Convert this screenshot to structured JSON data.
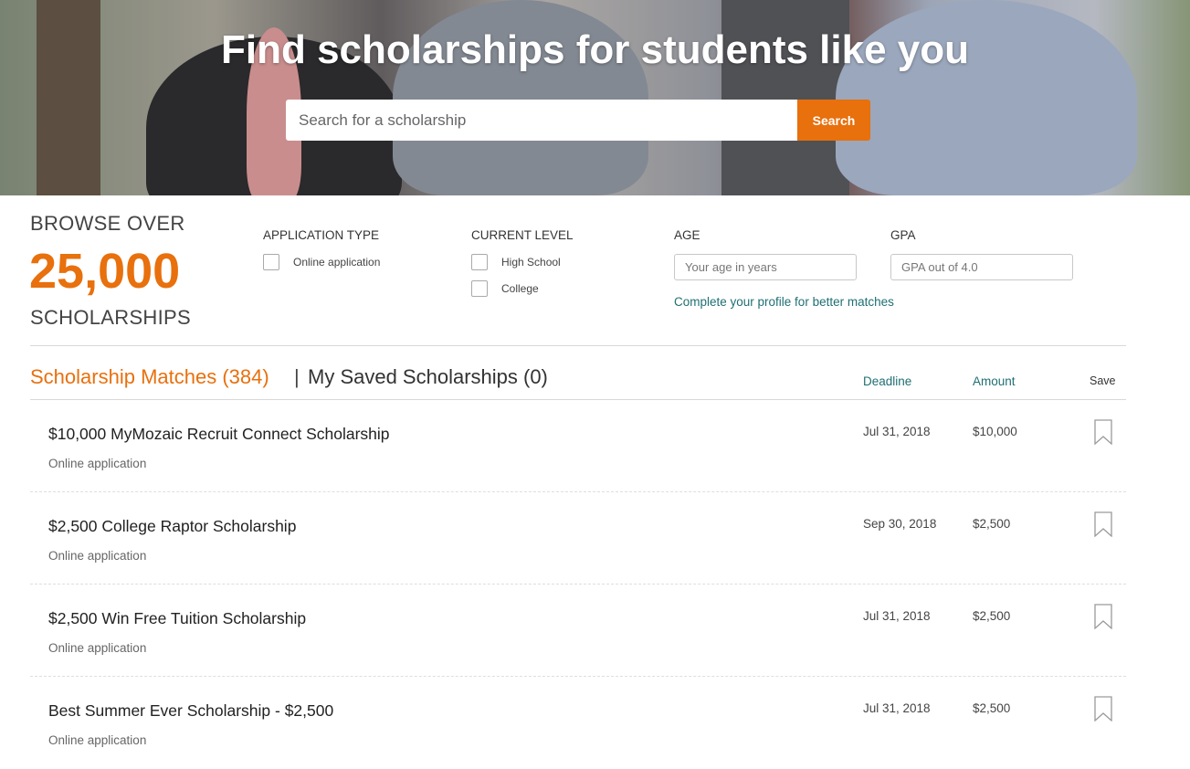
{
  "hero": {
    "title": "Find scholarships for students like you",
    "search_placeholder": "Search for a scholarship",
    "search_button": "Search"
  },
  "browse": {
    "over": "BROWSE OVER",
    "count": "25,000",
    "unit": "SCHOLARSHIPS"
  },
  "filters": {
    "application_type": {
      "label": "APPLICATION TYPE",
      "options": [
        "Online application"
      ]
    },
    "current_level": {
      "label": "CURRENT LEVEL",
      "options": [
        "High School",
        "College"
      ]
    },
    "age": {
      "label": "AGE",
      "placeholder": "Your age in years"
    },
    "gpa": {
      "label": "GPA",
      "placeholder": "GPA out of 4.0"
    },
    "profile_link": "Complete your profile for better matches"
  },
  "tabs": {
    "matches": "Scholarship Matches (384)",
    "separator": "|",
    "saved": "My Saved Scholarships (0)"
  },
  "columns": {
    "deadline": "Deadline",
    "amount": "Amount",
    "save": "Save"
  },
  "scholarships": [
    {
      "title": "$10,000 MyMozaic Recruit Connect Scholarship",
      "type": "Online application",
      "deadline": "Jul 31, 2018",
      "amount": "$10,000"
    },
    {
      "title": "$2,500 College Raptor Scholarship",
      "type": "Online application",
      "deadline": "Sep 30, 2018",
      "amount": "$2,500"
    },
    {
      "title": "$2,500 Win Free Tuition Scholarship",
      "type": "Online application",
      "deadline": "Jul 31, 2018",
      "amount": "$2,500"
    },
    {
      "title": "Best Summer Ever Scholarship - $2,500",
      "type": "Online application",
      "deadline": "Jul 31, 2018",
      "amount": "$2,500"
    }
  ],
  "colors": {
    "accent": "#e8700d",
    "link": "#1f6f73",
    "text": "#333333"
  },
  "icons": {
    "save": "bookmark-icon"
  }
}
